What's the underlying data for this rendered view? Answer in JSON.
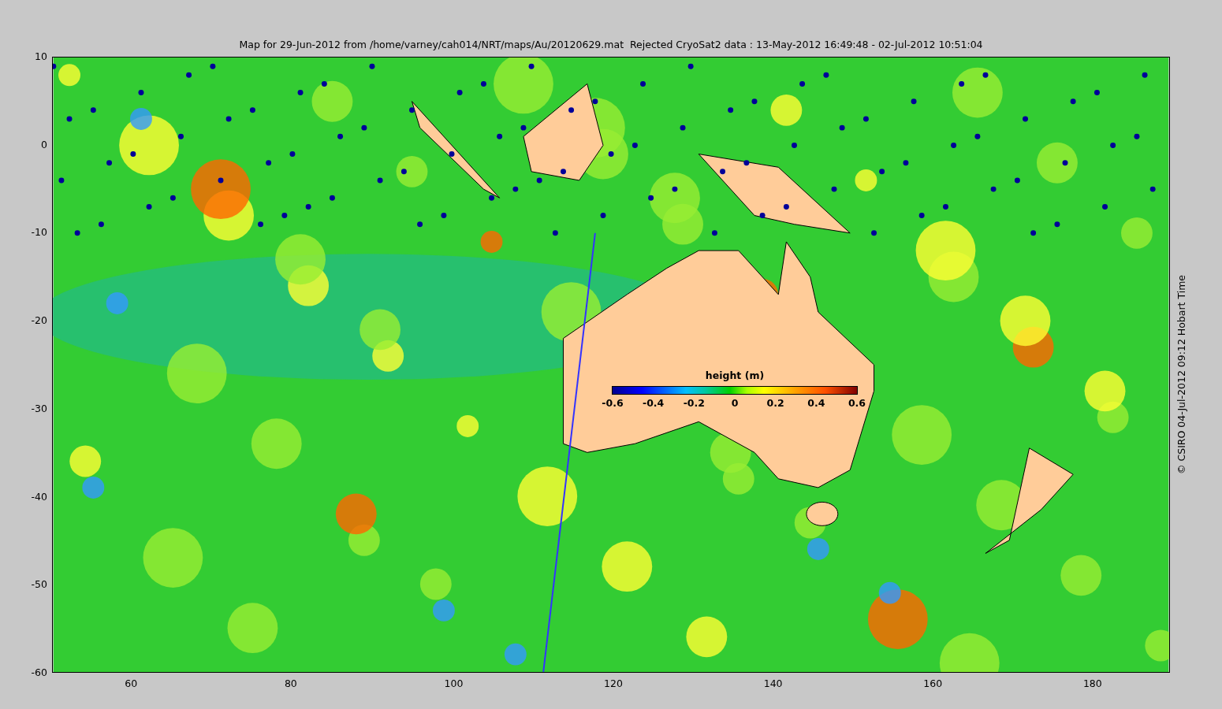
{
  "title": "Map for 29-Jun-2012 from /home/varney/cah014/NRT/maps/Au/20120629.mat  Rejected CryoSat2 data : 13-May-2012 16:49:48 - 02-Jul-2012 10:51:04",
  "y_ticks": [
    "10",
    "0",
    "-10",
    "-20",
    "-30",
    "-40",
    "-50",
    "-60"
  ],
  "x_ticks": [
    "60",
    "80",
    "100",
    "120",
    "140",
    "160",
    "180"
  ],
  "colorbar": {
    "label": "height (m)",
    "ticks": [
      "-0.6",
      "-0.4",
      "-0.2",
      "0",
      "0.2",
      "0.4",
      "0.6"
    ]
  },
  "credit": "© CSIRO 04-Jul-2012 09:12 Hobart Time"
}
